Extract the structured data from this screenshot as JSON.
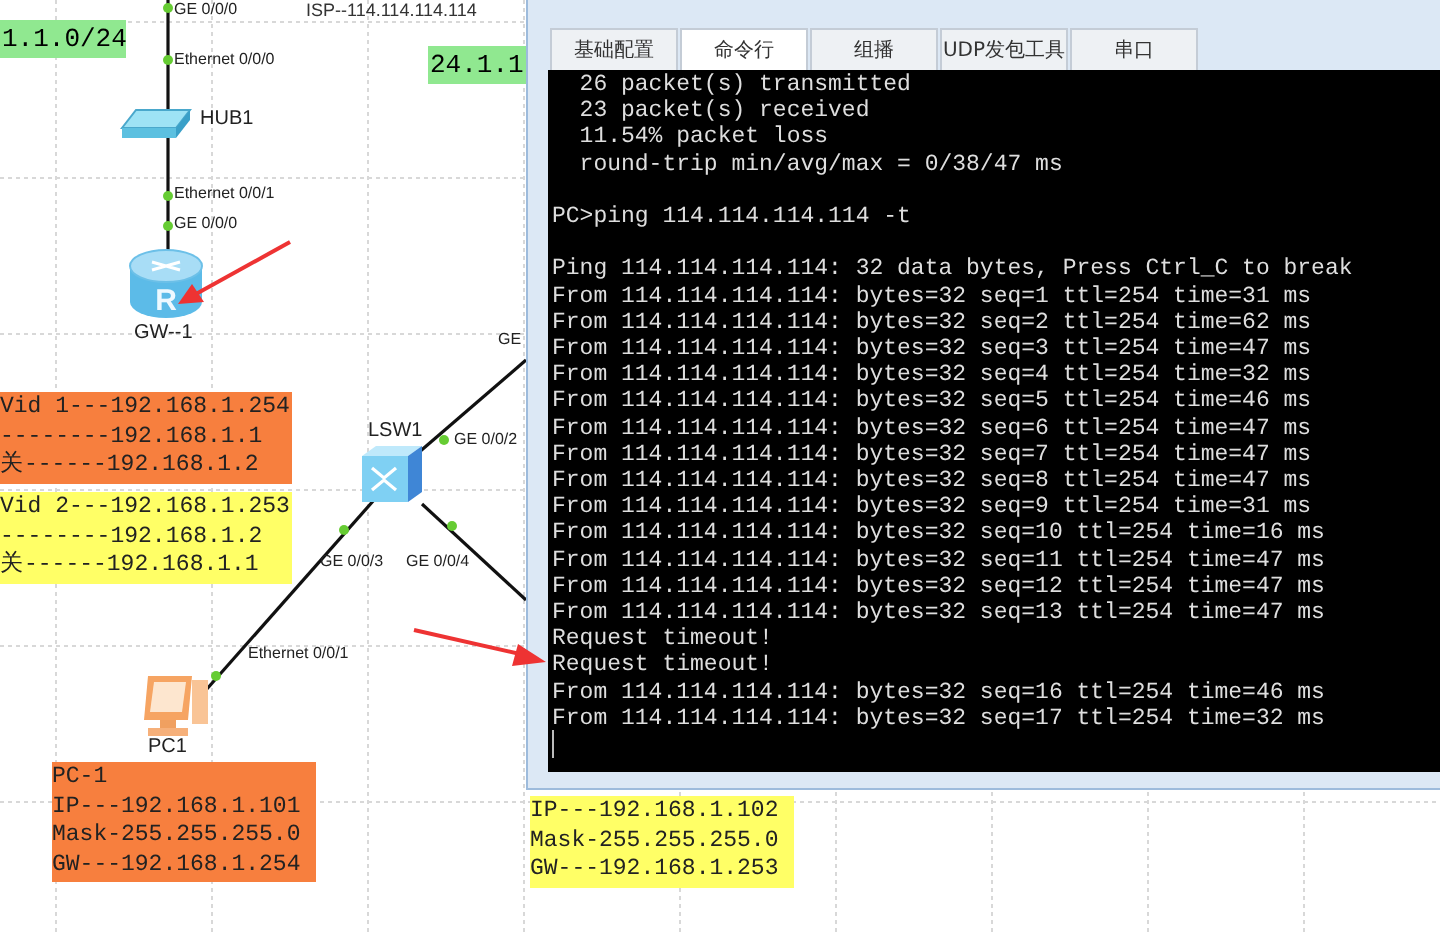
{
  "topology": {
    "isp_label": "ISP--114.114.114.114",
    "subnet_tags": [
      "1.1.0/24",
      "24.1.1"
    ],
    "devices": [
      {
        "kind": "hub",
        "label": "HUB1"
      },
      {
        "kind": "router",
        "label": "GW--1",
        "icon_letter": "R"
      },
      {
        "kind": "switch",
        "label": "LSW1"
      },
      {
        "kind": "pc",
        "label": "PC1"
      }
    ],
    "port_labels": [
      "GE 0/0/0",
      "Ethernet 0/0/0",
      "Ethernet 0/0/1",
      "GE 0/0/0",
      "GE 0/0/2",
      "GE",
      "GE 0/0/3",
      "GE 0/0/4",
      "Ethernet 0/0/1"
    ],
    "notes": [
      {
        "color": "#f77f3e",
        "lines": [
          "Vid 1---192.168.1.254",
          "--------192.168.1.1",
          "关------192.168.1.2"
        ]
      },
      {
        "color": "#ffff66",
        "lines": [
          "Vid 2---192.168.1.253",
          "--------192.168.1.2",
          "关------192.168.1.1"
        ]
      },
      {
        "color": "#f77f3e",
        "lines": [
          "PC-1",
          "IP---192.168.1.101",
          "Mask-255.255.255.0",
          "GW---192.168.1.254"
        ]
      },
      {
        "color": "#ffff66",
        "lines": [
          "IP---192.168.1.102",
          "Mask-255.255.255.0",
          "GW---192.168.1.253"
        ]
      }
    ]
  },
  "cli_window": {
    "tabs": [
      {
        "label": "基础配置",
        "selected": false
      },
      {
        "label": "命令行",
        "selected": true
      },
      {
        "label": "组播",
        "selected": false
      },
      {
        "label": "UDP发包工具",
        "selected": false
      },
      {
        "label": "串口",
        "selected": false
      }
    ],
    "output": [
      [
        "  26 packet(s) transmitted",
        "  23 packet(s) received",
        "  11.54% packet loss",
        "  round-trip min/avg/max = 0/38/47 ms"
      ],
      [
        "PC>ping 114.114.114.114 -t"
      ],
      [
        "Ping 114.114.114.114: 32 data bytes, Press Ctrl_C to break",
        "From 114.114.114.114: bytes=32 seq=1 ttl=254 time=31 ms",
        "From 114.114.114.114: bytes=32 seq=2 ttl=254 time=62 ms",
        "From 114.114.114.114: bytes=32 seq=3 ttl=254 time=47 ms",
        "From 114.114.114.114: bytes=32 seq=4 ttl=254 time=32 ms",
        "From 114.114.114.114: bytes=32 seq=5 ttl=254 time=46 ms",
        "From 114.114.114.114: bytes=32 seq=6 ttl=254 time=47 ms",
        "From 114.114.114.114: bytes=32 seq=7 ttl=254 time=47 ms",
        "From 114.114.114.114: bytes=32 seq=8 ttl=254 time=47 ms",
        "From 114.114.114.114: bytes=32 seq=9 ttl=254 time=31 ms",
        "From 114.114.114.114: bytes=32 seq=10 ttl=254 time=16 ms",
        "From 114.114.114.114: bytes=32 seq=11 ttl=254 time=47 ms",
        "From 114.114.114.114: bytes=32 seq=12 ttl=254 time=47 ms",
        "From 114.114.114.114: bytes=32 seq=13 ttl=254 time=47 ms",
        "Request timeout!",
        "Request timeout!",
        "From 114.114.114.114: bytes=32 seq=16 ttl=254 time=46 ms",
        "From 114.114.114.114: bytes=32 seq=17 ttl=254 time=32 ms"
      ]
    ]
  }
}
